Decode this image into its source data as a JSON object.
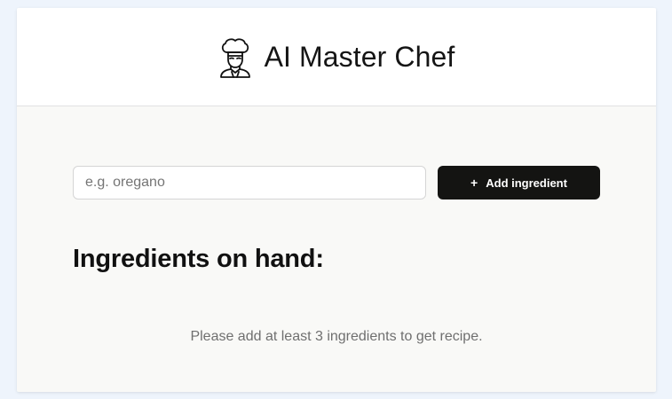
{
  "header": {
    "title": "AI Master Chef",
    "logo_icon": "chef-icon"
  },
  "ingredient_form": {
    "placeholder": "e.g. oregano",
    "value": "",
    "add_button_label": "Add ingredient",
    "add_button_icon": "plus-icon"
  },
  "ingredients_section": {
    "heading": "Ingredients on hand:",
    "items": [],
    "empty_message": "Please add at least 3 ingredients to get recipe."
  },
  "colors": {
    "page_background": "#eef4fc",
    "header_background": "#ffffff",
    "main_background": "#f9f9f7",
    "button_background": "#141412",
    "button_text": "#ffffff",
    "muted_text": "#6f6f6f"
  }
}
